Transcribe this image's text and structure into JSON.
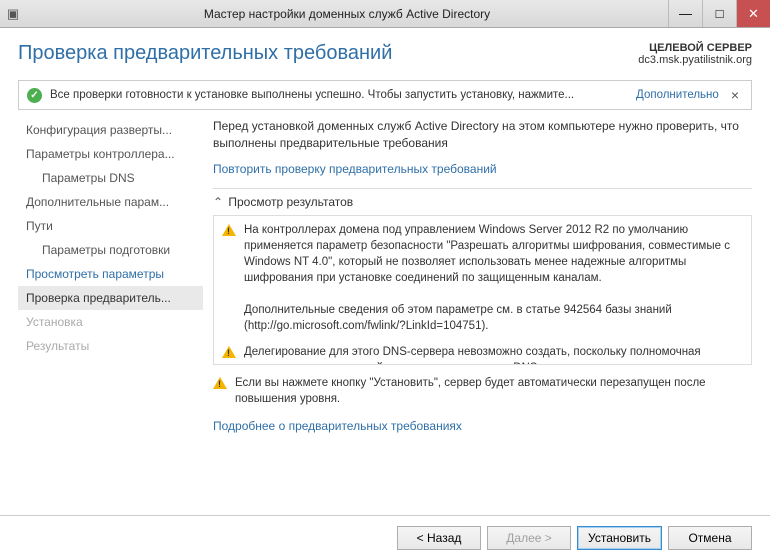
{
  "window": {
    "title": "Мастер настройки доменных служб Active Directory"
  },
  "header": {
    "title": "Проверка предварительных требований",
    "target_label": "ЦЕЛЕВОЙ СЕРВЕР",
    "target_server": "dc3.msk.pyatilistnik.org"
  },
  "status": {
    "message": "Все проверки готовности к установке выполнены успешно. Чтобы запустить установку, нажмите...",
    "more": "Дополнительно"
  },
  "nav": {
    "items": [
      {
        "label": "Конфигурация разверты...",
        "cls": ""
      },
      {
        "label": "Параметры контроллера...",
        "cls": ""
      },
      {
        "label": "Параметры DNS",
        "cls": "indent"
      },
      {
        "label": "Дополнительные парам...",
        "cls": ""
      },
      {
        "label": "Пути",
        "cls": ""
      },
      {
        "label": "Параметры подготовки",
        "cls": "indent"
      },
      {
        "label": "Просмотреть параметры",
        "cls": "link"
      },
      {
        "label": "Проверка предваритель...",
        "cls": "active"
      },
      {
        "label": "Установка",
        "cls": "disabled"
      },
      {
        "label": "Результаты",
        "cls": "disabled"
      }
    ]
  },
  "pane": {
    "intro": "Перед установкой доменных служб Active Directory на этом компьютере нужно проверить, что выполнены предварительные требования",
    "rerun_link": "Повторить проверку предварительных требований",
    "section_header": "Просмотр результатов",
    "warnings": [
      "На контроллерах домена под управлением Windows Server 2012 R2 по умолчанию применяется параметр безопасности \"Разрешать алгоритмы шифрования, совместимые с Windows NT 4.0\", который не позволяет использовать менее надежные алгоритмы шифрования при установке соединений по защищенным каналам.\n\nДополнительные сведения об этом параметре см. в статье 942564 базы знаний (http://go.microsoft.com/fwlink/?LinkId=104751).",
      "Делегирование для этого DNS-сервера невозможно создать, поскольку полномочная родительская зона не найдена или не использует DNS-сервер"
    ],
    "footer_warning": "Если вы нажмете кнопку \"Установить\", сервер будет автоматически перезапущен после повышения уровня.",
    "more_link": "Подробнее о предварительных требованиях"
  },
  "buttons": {
    "back": "< Назад",
    "next": "Далее >",
    "install": "Установить",
    "cancel": "Отмена"
  }
}
